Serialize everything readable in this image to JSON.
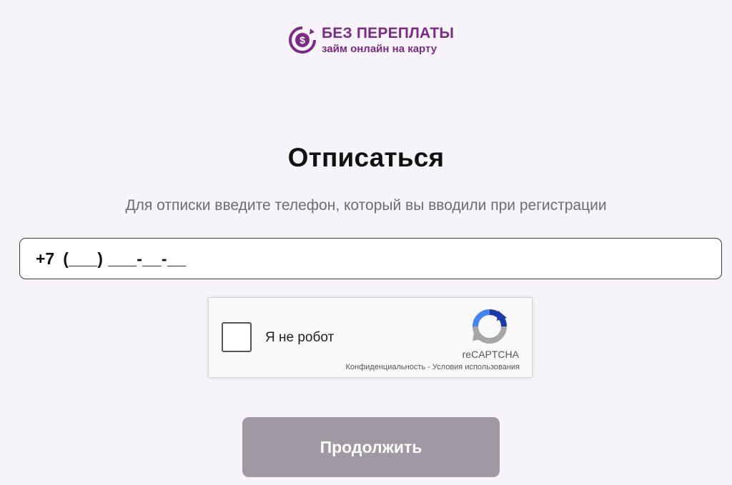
{
  "brand": {
    "title": "БЕЗ ПЕРЕПЛАТЫ",
    "subtitle": "займ онлайн на карту",
    "icon": "dollar-coin-icon",
    "color": "#7b2a86"
  },
  "page": {
    "title": "Отписаться",
    "subtitle": "Для отписки введите телефон, который вы вводили при регистрации"
  },
  "phone": {
    "prefix": "+7",
    "mask": "(___) ___-__-__"
  },
  "recaptcha": {
    "label": "Я не робот",
    "brand": "reCAPTCHA",
    "privacy": "Конфиденциальность",
    "separator": "-",
    "terms": "Условия использования",
    "checked": false
  },
  "actions": {
    "continue_label": "Продолжить",
    "button_color": "#9e99a2"
  }
}
